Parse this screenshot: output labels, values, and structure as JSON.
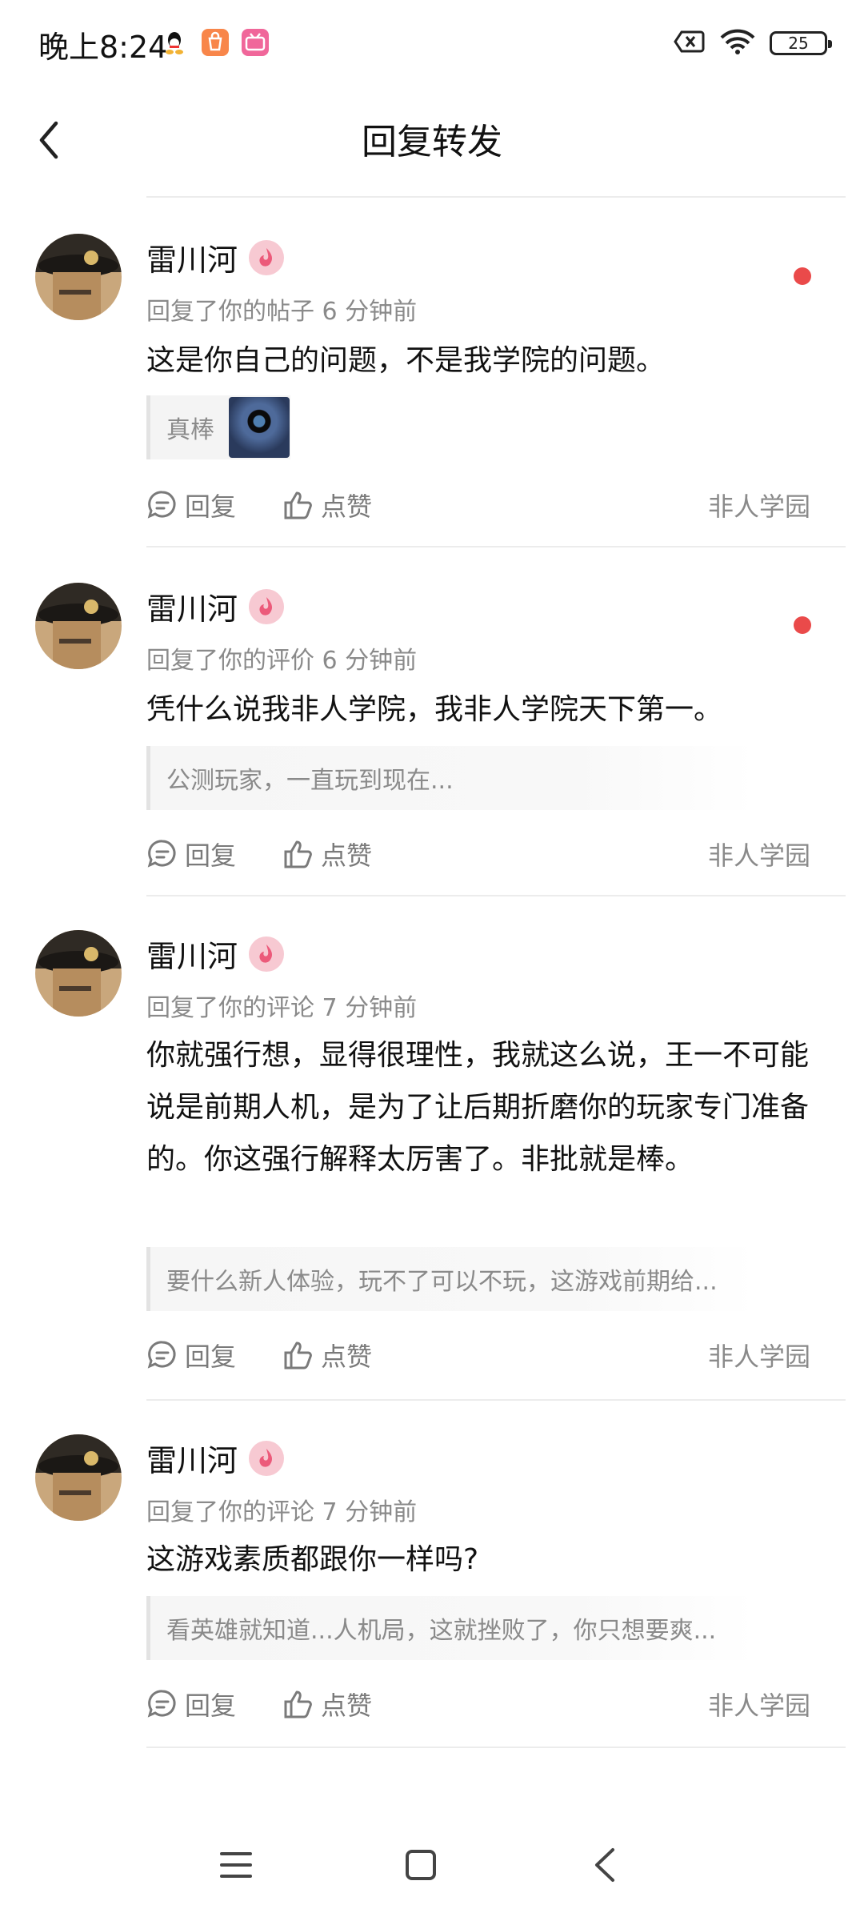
{
  "status_bar": {
    "time": "晚上8:24",
    "battery": "25",
    "icons": [
      "qq-icon",
      "mi-store-icon",
      "bilibili-icon",
      "no-sim-icon",
      "wifi-icon",
      "battery-icon"
    ]
  },
  "header": {
    "title": "回复转发",
    "back_icon": "chevron-left-icon"
  },
  "notifications": [
    {
      "user": "雷川河",
      "meta": "回复了你的帖子 6 分钟前",
      "content": "这是你自己的问题，不是我学院的问题。",
      "quote": "真棒",
      "has_thumb": true,
      "unread": true,
      "reply": "回复",
      "like": "点赞",
      "forum": "非人学园"
    },
    {
      "user": "雷川河",
      "meta": "回复了你的评价 6 分钟前",
      "content": "凭什么说我非人学院，我非人学院天下第一。",
      "quote": "公测玩家，一直玩到现在...",
      "unread": true,
      "reply": "回复",
      "like": "点赞",
      "forum": "非人学园"
    },
    {
      "user": "雷川河",
      "meta": "回复了你的评论 7 分钟前",
      "content": "你就强行想，显得很理性，我就这么说，王一不可能说是前期人机，是为了让后期折磨你的玩家专门准备的。你这强行解释太厉害了。非批就是棒。",
      "quote": "要什么新人体验，玩不了可以不玩，这游戏前期给...",
      "unread": false,
      "reply": "回复",
      "like": "点赞",
      "forum": "非人学园"
    },
    {
      "user": "雷川河",
      "meta": "回复了你的评论 7 分钟前",
      "content": "这游戏素质都跟你一样吗?",
      "quote": "看英雄就知道...人机局，这就挫败了，你只想要爽...",
      "unread": false,
      "reply": "回复",
      "like": "点赞",
      "forum": "非人学园"
    }
  ],
  "nav": {
    "icons": [
      "menu-icon",
      "home-square-icon",
      "back-triangle-icon"
    ]
  },
  "colors": {
    "unread": "#ea4a4a",
    "badge": "#f7c9d2",
    "muted": "#8a8a8a"
  }
}
